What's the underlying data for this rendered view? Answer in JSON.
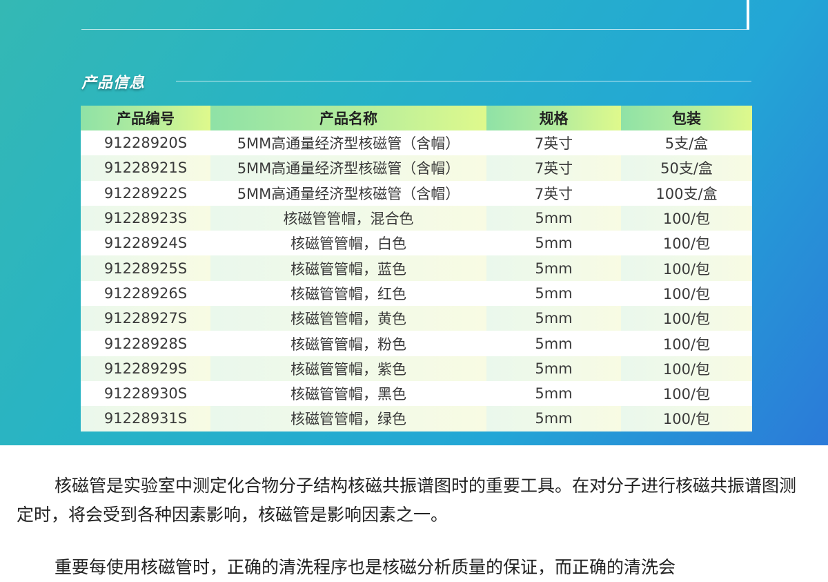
{
  "banner": {
    "top_text": "",
    "section_title": "产品信息"
  },
  "table": {
    "headers": [
      "产品编号",
      "产品名称",
      "规格",
      "包装"
    ],
    "rows": [
      [
        "91228920S",
        "5MM高通量经济型核磁管（含帽）",
        "7英寸",
        "5支/盒"
      ],
      [
        "91228921S",
        "5MM高通量经济型核磁管（含帽）",
        "7英寸",
        "50支/盒"
      ],
      [
        "91228922S",
        "5MM高通量经济型核磁管（含帽）",
        "7英寸",
        "100支/盒"
      ],
      [
        "91228923S",
        "核磁管管帽，混合色",
        "5mm",
        "100/包"
      ],
      [
        "91228924S",
        "核磁管管帽，白色",
        "5mm",
        "100/包"
      ],
      [
        "91228925S",
        "核磁管管帽，蓝色",
        "5mm",
        "100/包"
      ],
      [
        "91228926S",
        "核磁管管帽，红色",
        "5mm",
        "100/包"
      ],
      [
        "91228927S",
        "核磁管管帽，黄色",
        "5mm",
        "100/包"
      ],
      [
        "91228928S",
        "核磁管管帽，粉色",
        "5mm",
        "100/包"
      ],
      [
        "91228929S",
        "核磁管管帽，紫色",
        "5mm",
        "100/包"
      ],
      [
        "91228930S",
        "核磁管管帽，黑色",
        "5mm",
        "100/包"
      ],
      [
        "91228931S",
        "核磁管管帽，绿色",
        "5mm",
        "100/包"
      ]
    ]
  },
  "body": {
    "paragraph1": "核磁管是实验室中测定化合物分子结构核磁共振谱图时的重要工具。在对分子进行核磁共振谱图测定时，将会受到各种因素影响，核磁管是影响因素之一。",
    "paragraph2": "重要每使用核磁管时，正确的清洗程序也是核磁分析质量的保证，而正确的清洗会"
  },
  "colors": {
    "banner_start": "#34b8b4",
    "banner_end": "#2b7ad8",
    "header_start": "#8fe2a6",
    "header_end": "#dff98c"
  }
}
